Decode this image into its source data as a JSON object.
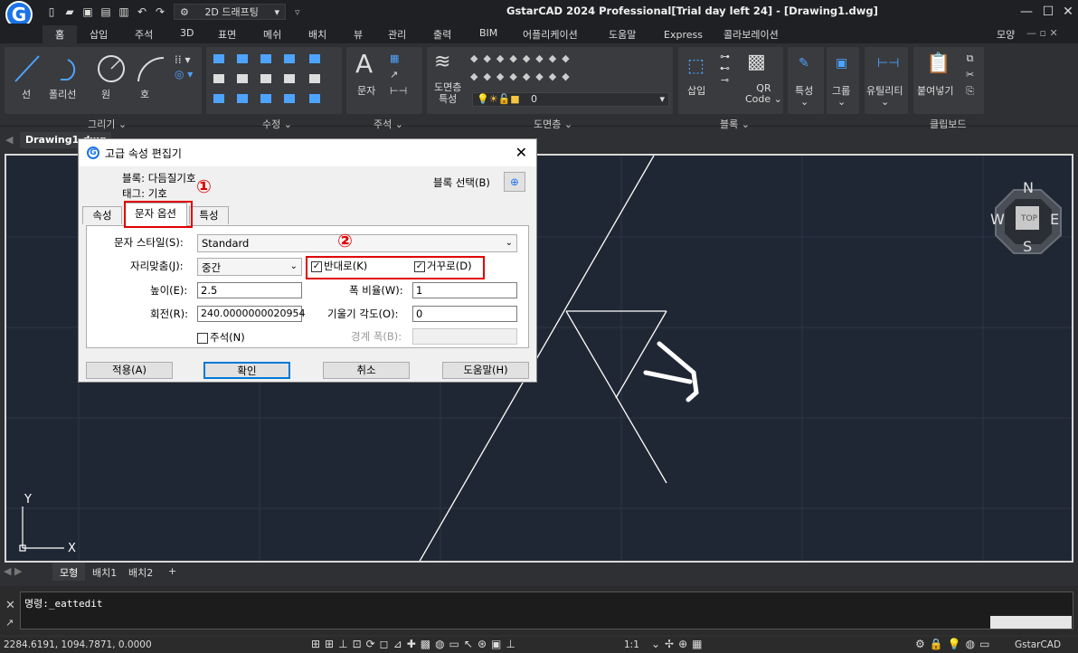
{
  "app": {
    "title": "GstarCAD 2024 Professional[Trial day left 24] - [Drawing1.dwg]",
    "logo": "G",
    "workspace": "2D 드래프팅",
    "shape_menu": "모양"
  },
  "ribbon_tabs": [
    "홈",
    "삽입",
    "주석",
    "3D",
    "표면",
    "메쉬",
    "배치",
    "뷰",
    "관리",
    "출력",
    "BIM",
    "어플리케이션",
    "도움말",
    "Express",
    "콜라보레이션"
  ],
  "ribbon": {
    "draw": {
      "label": "그리기",
      "tools": [
        "선",
        "폴리선",
        "원",
        "호"
      ]
    },
    "modify": {
      "label": "수정"
    },
    "annotation": {
      "label": "주석",
      "tool": "문자",
      "glyph": "A"
    },
    "layer": {
      "label": "도면층",
      "tool1": "도면층",
      "tool2": "특성",
      "layer_value": "0"
    },
    "block": {
      "label": "블록",
      "insert": "삽입",
      "qr1": "QR",
      "qr2": "Code"
    },
    "properties": {
      "label": "특성"
    },
    "group": {
      "label": "그룹"
    },
    "utility": {
      "label": "유틸리티"
    },
    "clipboard": {
      "label": "클립보드",
      "paste": "붙여넣기"
    }
  },
  "doc_tab": "Drawing1.dwg",
  "viewcube": {
    "n": "N",
    "s": "S",
    "e": "E",
    "w": "W",
    "top": "TOP"
  },
  "ucs": {
    "x": "X",
    "y": "Y"
  },
  "layout_tabs": [
    "모형",
    "배치1",
    "배치2",
    "+"
  ],
  "command": {
    "text": "명령:_eattedit"
  },
  "status": {
    "coords": "2284.6191, 1094.7871, 0.0000",
    "scale": "1:1",
    "brand": "GstarCAD"
  },
  "dialog": {
    "title": "고급 속성 편집기",
    "block_label": "블록: 다듬질기호",
    "tag_label": "태그: 기호",
    "select_block": "블록 선택(B)",
    "tabs": [
      "속성",
      "문자 옵션",
      "특성"
    ],
    "active_tab": "문자 옵션",
    "text_style_label": "문자 스타일(S):",
    "text_style_value": "Standard",
    "justify_label": "자리맞춤(J):",
    "justify_value": "중간",
    "backwards_label": "반대로(K)",
    "backwards_checked": true,
    "upside_down_label": "거꾸로(D)",
    "upside_down_checked": true,
    "height_label": "높이(E):",
    "height_value": "2.5",
    "width_factor_label": "폭 비율(W):",
    "width_factor_value": "1",
    "rotation_label": "회전(R):",
    "rotation_value": "240.0000000020954",
    "oblique_label": "기울기 각도(O):",
    "oblique_value": "0",
    "annotative_label": "주석(N)",
    "boundary_label": "경계 폭(B):",
    "buttons": {
      "apply": "적용(A)",
      "ok": "확인",
      "cancel": "취소",
      "help": "도움말(H)"
    },
    "markers": [
      "①",
      "②"
    ]
  },
  "colors": {
    "viewport": "#202734",
    "accent": "#0078d7",
    "highlight": "#e00000"
  }
}
